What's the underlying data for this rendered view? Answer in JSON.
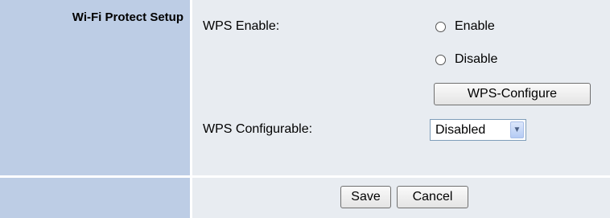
{
  "section_title": "Wi-Fi Protect Setup",
  "wps_enable": {
    "label": "WPS Enable:",
    "options": [
      "Enable",
      "Disable"
    ],
    "selected": null
  },
  "wps_configure_button": "WPS-Configure",
  "wps_configurable": {
    "label": "WPS Configurable:",
    "value": "Disabled"
  },
  "footer": {
    "save_label": "Save",
    "cancel_label": "Cancel"
  }
}
